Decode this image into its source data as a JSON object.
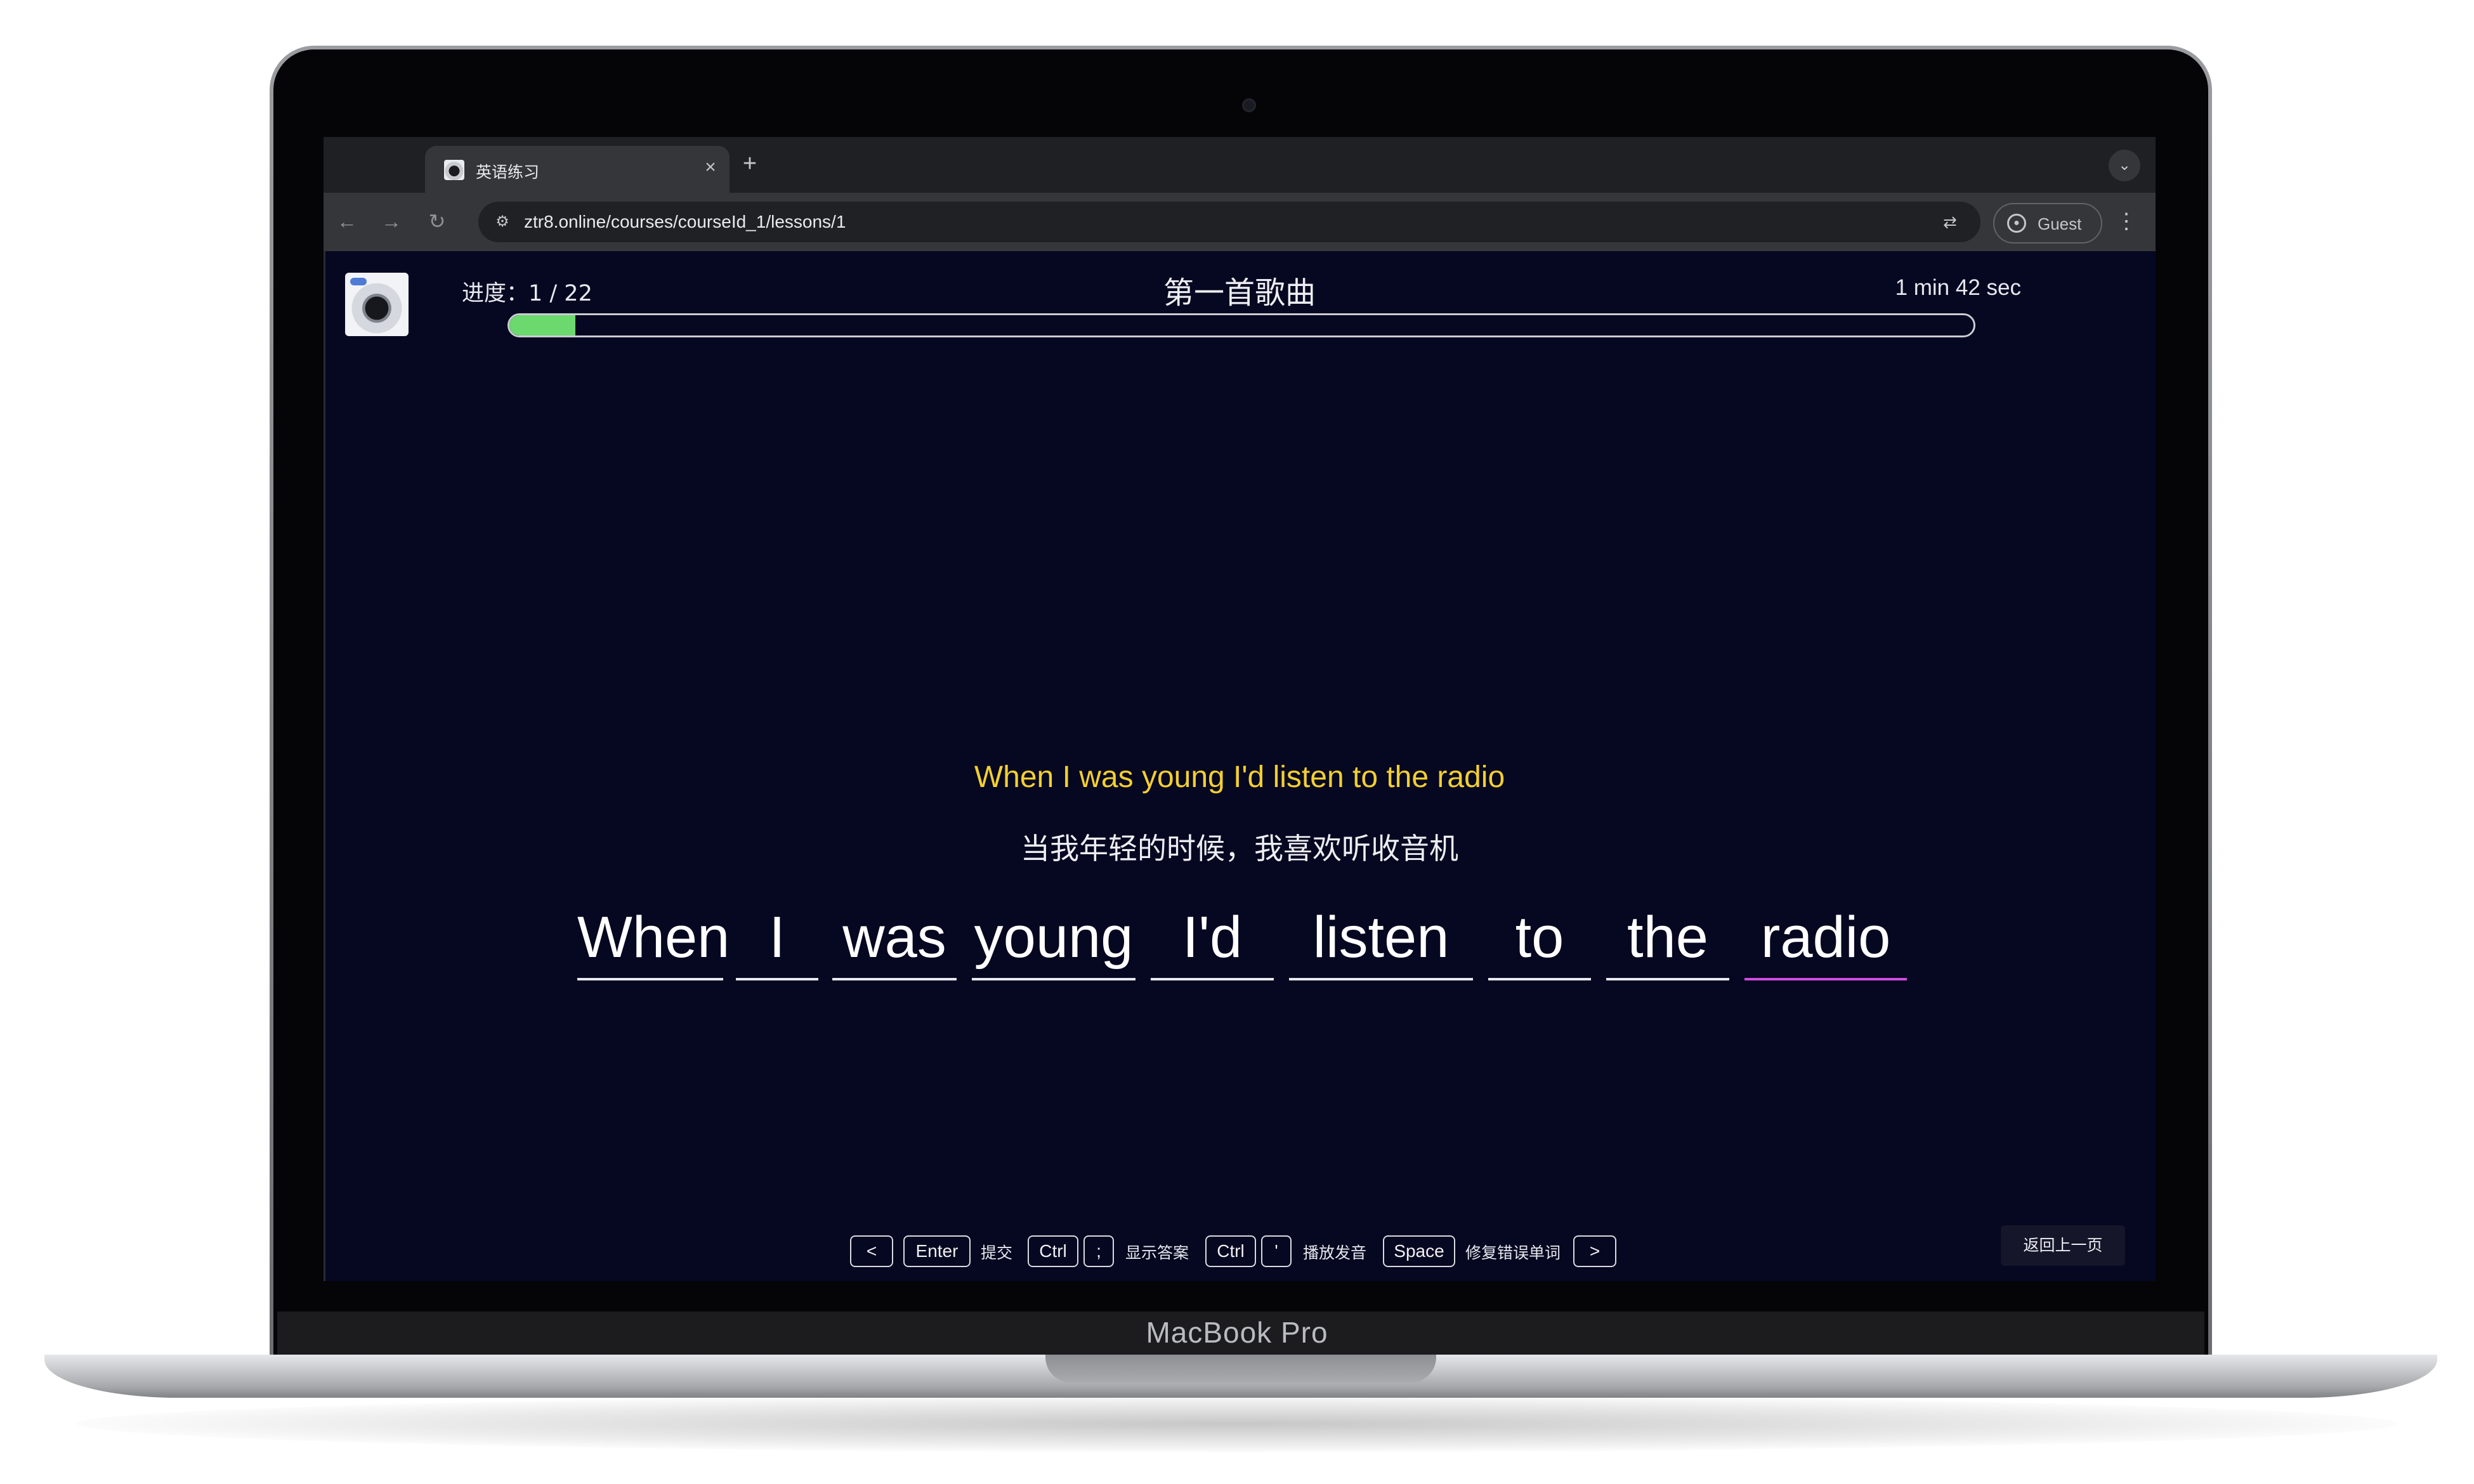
{
  "device": {
    "label": "MacBook Pro"
  },
  "browser": {
    "tab": {
      "title": "英语练习",
      "favicon": "vinyl-record-logo",
      "close_icon": "×"
    },
    "new_tab_icon": "+",
    "tab_menu_icon": "⌄",
    "nav": {
      "back_icon": "←",
      "forward_icon": "→",
      "reload_icon": "↻"
    },
    "omnibox": {
      "site_info_icon": "⚙",
      "url": "ztr8.online/courses/courseId_1/lessons/1",
      "translate_icon": "⇄"
    },
    "profile": {
      "label": "Guest",
      "icon": "person-circle"
    },
    "menu_icon": "⋮"
  },
  "lesson": {
    "progress_label": "进度：1 / 22",
    "progress": {
      "current": 1,
      "total": 22,
      "fraction": 0.045
    },
    "title": "第一首歌曲",
    "timer": "1 min 42 sec",
    "sentence_en": "When I was young I'd listen to the radio",
    "sentence_zh": "当我年轻的时候，我喜欢听收音机",
    "words": [
      "When",
      "I",
      "was",
      "young",
      "I'd",
      "listen",
      "to",
      "the",
      "radio"
    ],
    "active_word_index": 8,
    "colors": {
      "background": "#060720",
      "english": "#f2cf31",
      "progress": "#6bd96e",
      "active_underline": "#d04be0"
    }
  },
  "shortcuts": {
    "prev_key": "<",
    "submit_key": "Enter",
    "submit_label": "提交",
    "answer_key1": "Ctrl",
    "answer_key2": ";",
    "answer_label": "显示答案",
    "play_key1": "Ctrl",
    "play_key2": "'",
    "play_label": "播放发音",
    "fix_key": "Space",
    "fix_label": "修复错误单词",
    "next_key": ">"
  },
  "back_button": "返回上一页"
}
